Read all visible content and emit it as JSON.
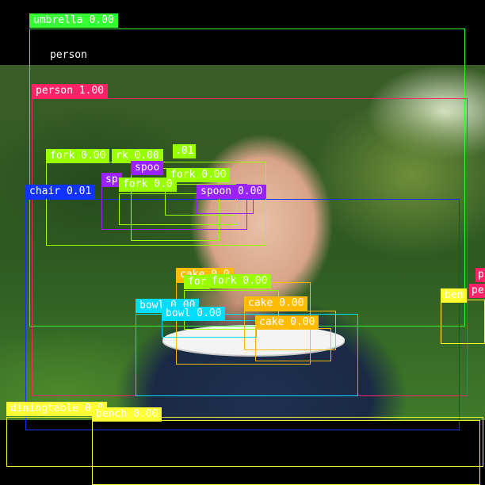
{
  "image": {
    "description_free": true
  },
  "colors": {
    "umbrella": "#33ff33",
    "person": "#ff2266",
    "fork": "#99ff00",
    "spoon": "#9922ff",
    "chair": "#1133ff",
    "cake": "#ffbb00",
    "bowl": "#00ddff",
    "diningtable": "#ffff33",
    "bench": "#ffff33"
  },
  "labels": {
    "umbrella": "umbrella 0.00",
    "person_top": "person",
    "person": "person 1.00",
    "fork_1": "fork 0.00",
    "fork_2": "rk 0.00",
    "fork_3": ".01",
    "spoon_1": "spoo",
    "fork_4": "fork 0.00",
    "spoon_2": "sp",
    "fork_5": "fork 0.0",
    "spoon_3": "spoon 0.00",
    "chair": "chair 0.01",
    "cake_1": "cake 0.0",
    "fork_6": "for",
    "fork_7": "fork 0.00",
    "bowl_1": "bowl 0.00",
    "cake_2": "cake 0.00",
    "bowl_2": "bowl 0.00",
    "cake_3": "cake 0.00",
    "diningtable": "diningtable 0.0",
    "bench": "bench 0.00",
    "bench_right": "ben",
    "person_right_1": "p",
    "person_right_2": "pe"
  }
}
